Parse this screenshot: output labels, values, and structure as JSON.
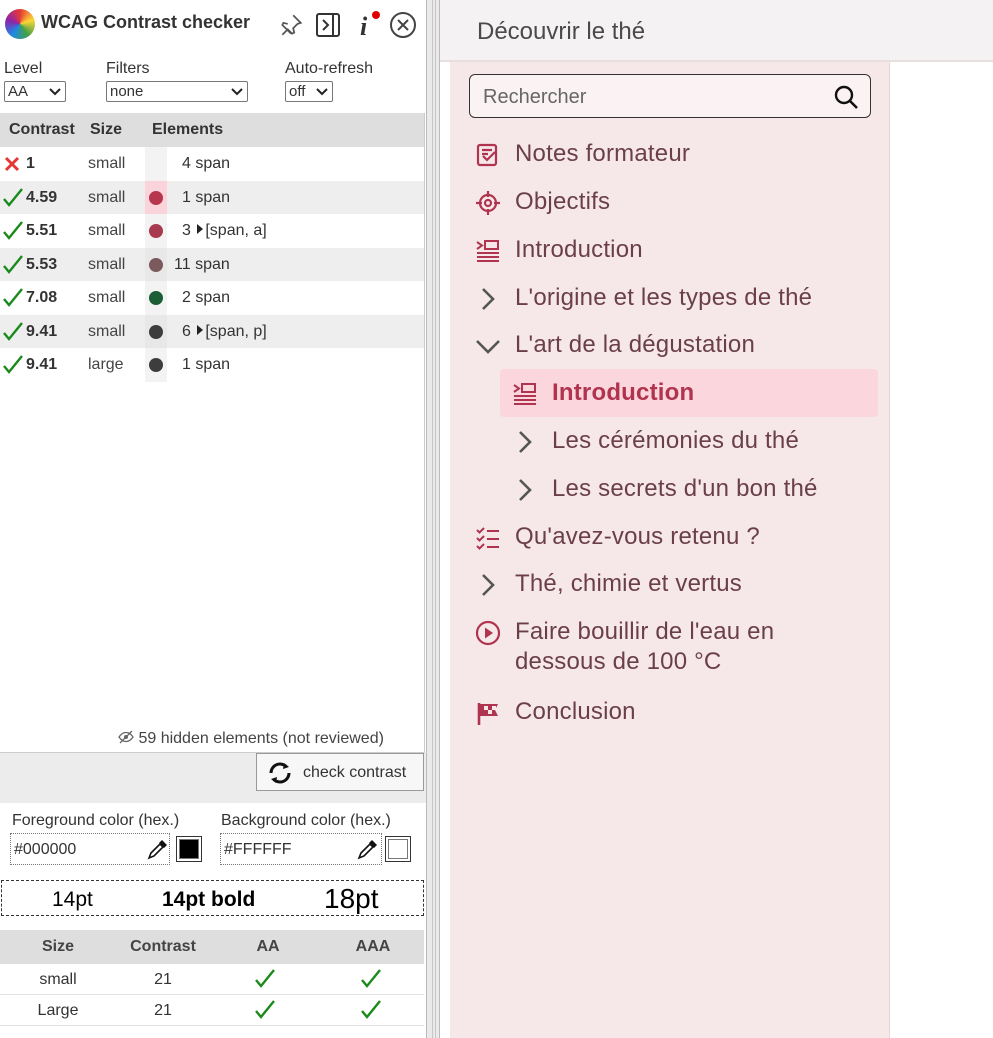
{
  "checker": {
    "title": "WCAG Contrast checker",
    "icons": [
      "pin-icon",
      "dock-panel-icon",
      "info-icon",
      "close-icon"
    ],
    "level": {
      "label": "Level",
      "value": "AA"
    },
    "filters": {
      "label": "Filters",
      "value": "none"
    },
    "autorefresh": {
      "label": "Auto-refresh",
      "value": "off"
    },
    "columns": {
      "contrast": "Contrast",
      "size": "Size",
      "elements": "Elements"
    },
    "rows": [
      {
        "status": "fail",
        "contrast": "1",
        "size": "small",
        "color": "",
        "count": "4",
        "expandable": false,
        "elements": "span"
      },
      {
        "status": "pass",
        "contrast": "4.59",
        "size": "small",
        "color": "#b7354d",
        "count": "1",
        "expandable": false,
        "elements": "span"
      },
      {
        "status": "pass",
        "contrast": "5.51",
        "size": "small",
        "color": "#a83a4f",
        "count": "3",
        "expandable": true,
        "elements": "[span, a]"
      },
      {
        "status": "pass",
        "contrast": "5.53",
        "size": "small",
        "color": "#7b5a5e",
        "count": "11",
        "expandable": false,
        "elements": "span"
      },
      {
        "status": "pass",
        "contrast": "7.08",
        "size": "small",
        "color": "#1b5e35",
        "count": "2",
        "expandable": false,
        "elements": "span"
      },
      {
        "status": "pass",
        "contrast": "9.41",
        "size": "small",
        "color": "#3d3d3d",
        "count": "6",
        "expandable": true,
        "elements": "[span, p]"
      },
      {
        "status": "pass",
        "contrast": "9.41",
        "size": "large",
        "color": "#3d3d3d",
        "count": "1",
        "expandable": false,
        "elements": "span"
      }
    ],
    "hidden_note": "59 hidden elements (not reviewed)",
    "check_button": "check contrast",
    "foreground": {
      "label": "Foreground color (hex.)",
      "value": "#000000",
      "swatch": "#000000"
    },
    "background": {
      "label": "Background color (hex.)",
      "value": "#FFFFFF",
      "swatch": "#ffffff"
    },
    "preview": {
      "normal": "14pt",
      "bold": "14pt bold",
      "large": "18pt"
    },
    "results": {
      "headers": {
        "size": "Size",
        "contrast": "Contrast",
        "aa": "AA",
        "aaa": "AAA"
      },
      "rows": [
        {
          "size": "small",
          "contrast": "21",
          "aa": true,
          "aaa": true
        },
        {
          "size": "Large",
          "contrast": "21",
          "aa": true,
          "aaa": true
        }
      ]
    },
    "colors": {
      "pass": "#1a8a1a",
      "fail": "#e53935",
      "header_bg": "#dedede"
    }
  },
  "course": {
    "title": "Découvrir le thé",
    "search_placeholder": "Rechercher",
    "items": [
      {
        "label": "Notes formateur",
        "icon": "notes-icon"
      },
      {
        "label": "Objectifs",
        "icon": "target-icon"
      },
      {
        "label": "Introduction",
        "icon": "intro-icon"
      },
      {
        "label": "L'origine et les types de thé",
        "icon": "chevron-right-icon"
      },
      {
        "label": "L'art de la dégustation",
        "icon": "chevron-down-icon"
      }
    ],
    "subitems": [
      {
        "label": "Introduction",
        "icon": "intro-icon",
        "active": true
      },
      {
        "label": "Les cérémonies du thé",
        "icon": "chevron-right-icon"
      },
      {
        "label": "Les secrets d'un bon thé",
        "icon": "chevron-right-icon"
      }
    ],
    "items2": [
      {
        "label": "Qu'avez-vous retenu ?",
        "icon": "checklist-icon"
      },
      {
        "label": "Thé, chimie et vertus",
        "icon": "chevron-right-icon"
      },
      {
        "label_line1": "Faire bouillir de l'eau en",
        "label_line2": "dessous de 100 °C",
        "icon": "play-circle-icon"
      },
      {
        "label": "Conclusion",
        "icon": "flag-icon"
      }
    ],
    "colors": {
      "accent": "#b0344f",
      "text": "#6b3f4a",
      "nav_bg": "#f6e8e8",
      "active_bg": "#fbd6dc"
    }
  }
}
